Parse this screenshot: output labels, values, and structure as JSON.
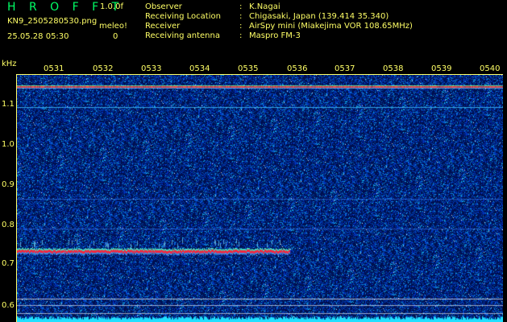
{
  "header": {
    "brand": "H R O F F T",
    "version": "1.0.0f",
    "filename": "KN9_2505280530.png",
    "datetime": "25.05.28 05:30",
    "meleo_label": "meleo!",
    "meleo_value": "0"
  },
  "station": [
    {
      "key": "Observer",
      "sep": ":",
      "value": "K.Nagai"
    },
    {
      "key": "Receiving Location",
      "sep": ":",
      "value": "Chigasaki, Japan (139.414 35.340)"
    },
    {
      "key": "Receiver",
      "sep": ":",
      "value": "AirSpy mini (Miakejima VOR 108.65MHz)"
    },
    {
      "key": "Receiving antenna",
      "sep": ":",
      "value": "Maspro FM-3"
    }
  ],
  "axes": {
    "y_unit": "kHz",
    "x_ticks": [
      "0531",
      "0532",
      "0533",
      "0534",
      "0535",
      "0536",
      "0537",
      "0538",
      "0539",
      "0540"
    ],
    "y_ticks": [
      "1.1",
      "1.0",
      "0.9",
      "0.8",
      "0.7",
      "0.6"
    ]
  },
  "colors": {
    "background": "#001050",
    "text": "#ffff66",
    "brand": "#00ff66",
    "echo": "#ff3030"
  }
}
